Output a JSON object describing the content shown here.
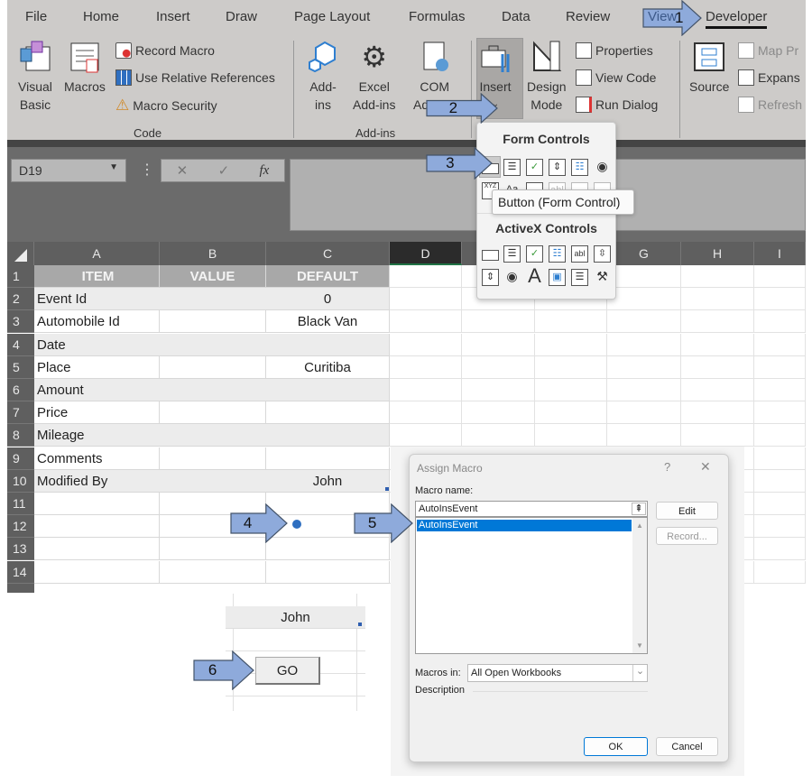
{
  "ribbon": {
    "tabs": [
      "File",
      "Home",
      "Insert",
      "Draw",
      "Page Layout",
      "Formulas",
      "Data",
      "Review",
      "View",
      "Developer"
    ],
    "active_tab": "Developer",
    "code_group": {
      "label": "Code",
      "visual_basic": [
        "Visual",
        "Basic"
      ],
      "macros": "Macros",
      "record_macro": "Record Macro",
      "use_relative": "Use Relative References",
      "macro_security": "Macro Security"
    },
    "addins_group": {
      "label": "Add-ins",
      "addins": [
        "Add-",
        "ins"
      ],
      "excel_addins": [
        "Excel",
        "Add-ins"
      ],
      "com_addins": [
        "COM",
        "Add-ins"
      ]
    },
    "controls_group": {
      "insert": "Insert",
      "design_mode": [
        "Design",
        "Mode"
      ],
      "properties": "Properties",
      "view_code": "View Code",
      "run_dialog": "Run Dialog"
    },
    "xml_group": {
      "source": "Source",
      "map_properties": "Map Pr",
      "expansion": "Expans",
      "refresh": "Refresh"
    }
  },
  "formula_bar": {
    "name_box": "D19",
    "fx": "fx",
    "cancel": "✕",
    "enter": "✓"
  },
  "columns": [
    "A",
    "B",
    "C",
    "D",
    "E",
    "F",
    "G",
    "H",
    "I"
  ],
  "rows": [
    {
      "n": "1",
      "a": "ITEM",
      "b": "VALUE",
      "c": "DEFAULT"
    },
    {
      "n": "2",
      "a": "Event Id",
      "b": "",
      "c": "0"
    },
    {
      "n": "3",
      "a": "Automobile Id",
      "b": "",
      "c": "Black Van"
    },
    {
      "n": "4",
      "a": "Date",
      "b": "",
      "c": ""
    },
    {
      "n": "5",
      "a": "Place",
      "b": "",
      "c": "Curitiba"
    },
    {
      "n": "6",
      "a": "Amount",
      "b": "",
      "c": ""
    },
    {
      "n": "7",
      "a": "Price",
      "b": "",
      "c": ""
    },
    {
      "n": "8",
      "a": "Mileage",
      "b": "",
      "c": ""
    },
    {
      "n": "9",
      "a": "Comments",
      "b": "",
      "c": ""
    },
    {
      "n": "10",
      "a": "Modified By",
      "b": "",
      "c": "John"
    },
    {
      "n": "11",
      "a": "",
      "b": "",
      "c": ""
    },
    {
      "n": "12",
      "a": "",
      "b": "",
      "c": ""
    },
    {
      "n": "13",
      "a": "",
      "b": "",
      "c": ""
    },
    {
      "n": "14",
      "a": "",
      "b": "",
      "c": ""
    }
  ],
  "insert_dropdown": {
    "form_controls": "Form Controls",
    "activex_controls": "ActiveX Controls",
    "tooltip": "Button (Form Control)",
    "xyz": "XYZ",
    "aa": "Aa",
    "abl": "abl",
    "a": "A"
  },
  "snippet": {
    "cell_value": "John",
    "go_button": "GO"
  },
  "dialog": {
    "title": "Assign Macro",
    "help": "?",
    "close": "✕",
    "macro_name_label": "Macro name:",
    "macro_name_value": "AutoInsEvent",
    "macro_list": [
      "AutoInsEvent"
    ],
    "edit": "Edit",
    "record": "Record...",
    "macros_in_label": "Macros in:",
    "macros_in_value": "All Open Workbooks",
    "description_label": "Description",
    "ok": "OK",
    "cancel": "Cancel"
  },
  "callouts": [
    "1",
    "2",
    "3",
    "4",
    "5",
    "6"
  ],
  "colors": {
    "callout_fill": "#8eaadb",
    "selection": "#0078d7",
    "header_gray": "#5f5f5f"
  }
}
